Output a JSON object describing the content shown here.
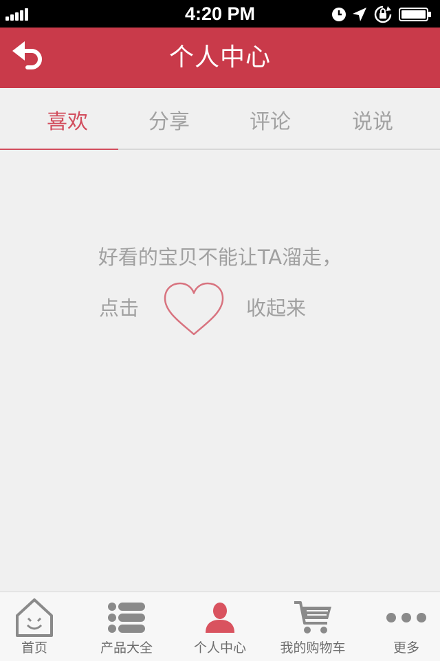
{
  "status_bar": {
    "time": "4:20 PM",
    "icons": [
      "signal-bars-icon",
      "clock-icon",
      "location-arrow-icon",
      "rotation-lock-icon",
      "battery-icon"
    ]
  },
  "header": {
    "title": "个人中心",
    "back_icon": "back-arrow-icon",
    "background": "#c93a4a"
  },
  "tabs": [
    {
      "label": "喜欢",
      "active": true
    },
    {
      "label": "分享",
      "active": false
    },
    {
      "label": "评论",
      "active": false
    },
    {
      "label": "说说",
      "active": false
    }
  ],
  "accent_color": "#d24d5d",
  "empty_state": {
    "line1": "好看的宝贝不能让TA溜走，",
    "prefix": "点击",
    "heart_icon": "heart-outline-icon",
    "suffix": "收起来"
  },
  "bottom_nav": [
    {
      "label": "首页",
      "icon": "home-face-icon",
      "active": false
    },
    {
      "label": "产品大全",
      "icon": "list-icon",
      "active": false
    },
    {
      "label": "个人中心",
      "icon": "user-icon",
      "active": true
    },
    {
      "label": "我的购物车",
      "icon": "cart-icon",
      "active": false
    },
    {
      "label": "更多",
      "icon": "more-dots-icon",
      "active": false
    }
  ]
}
